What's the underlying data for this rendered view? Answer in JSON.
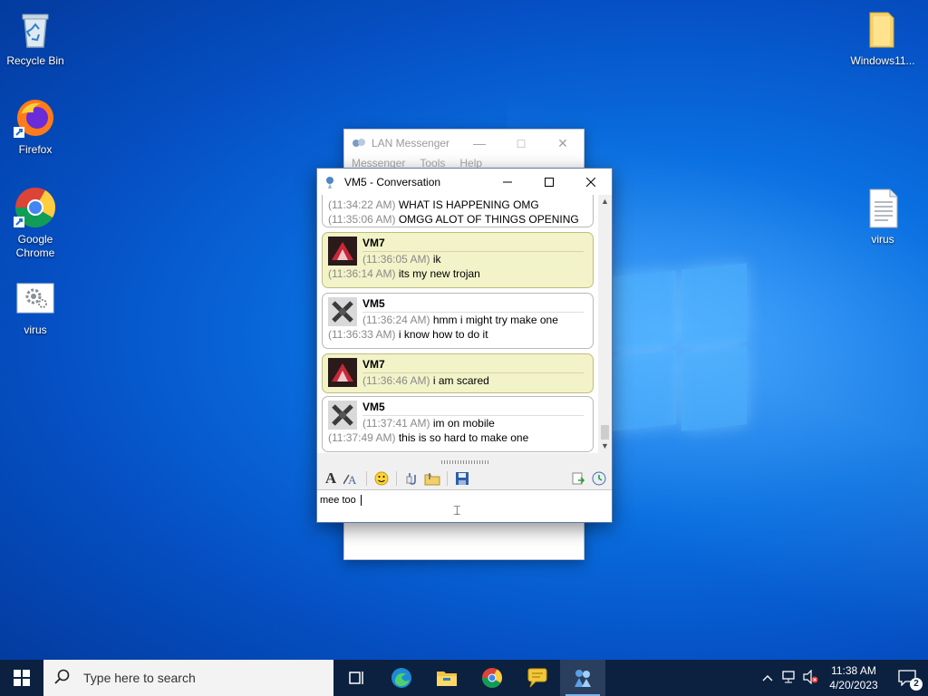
{
  "desktop": {
    "icons": [
      {
        "label": "Recycle Bin",
        "icon": "recycle-bin-icon"
      },
      {
        "label": "Firefox",
        "icon": "firefox-icon"
      },
      {
        "label": "Google Chrome",
        "icon": "chrome-icon"
      },
      {
        "label": "virus",
        "icon": "settings-file-icon"
      },
      {
        "label": "Windows11...",
        "icon": "folder-icon"
      },
      {
        "label": "virus",
        "icon": "text-document-icon"
      }
    ]
  },
  "lan_messenger": {
    "title": "LAN Messenger",
    "menu": [
      "Messenger",
      "Tools",
      "Help"
    ]
  },
  "conversation": {
    "title": "VM5 - Conversation",
    "top_lines": [
      {
        "time": "(11:34:22 AM)",
        "text": "WHAT IS HAPPENING OMG"
      },
      {
        "time": "(11:35:06 AM)",
        "text": "OMGG ALOT OF THINGS OPENING"
      }
    ],
    "messages": [
      {
        "sender": "VM7",
        "lines": [
          {
            "time": "(11:36:05 AM)",
            "text": "ik"
          },
          {
            "time": "(11:36:14 AM)",
            "text": "its my new trojan"
          }
        ]
      },
      {
        "sender": "VM5",
        "lines": [
          {
            "time": "(11:36:24 AM)",
            "text": "hmm i might try make one"
          },
          {
            "time": "(11:36:33 AM)",
            "text": "i know how to do it"
          }
        ]
      },
      {
        "sender": "VM7",
        "lines": [
          {
            "time": "(11:36:46 AM)",
            "text": "i am scared"
          }
        ]
      },
      {
        "sender": "VM5",
        "lines": [
          {
            "time": "(11:37:41 AM)",
            "text": "im on mobile"
          },
          {
            "time": "(11:37:49 AM)",
            "text": "this is so hard to make one"
          }
        ]
      }
    ],
    "input_value": "mee too "
  },
  "taskbar": {
    "search_placeholder": "Type here to search",
    "time": "11:38 AM",
    "date": "4/20/2023",
    "notification_count": "2"
  },
  "colors": {
    "vm7_bubble": "#f3f3c9",
    "vm5_bubble": "#ffffff",
    "taskbar": "#0c2140"
  }
}
